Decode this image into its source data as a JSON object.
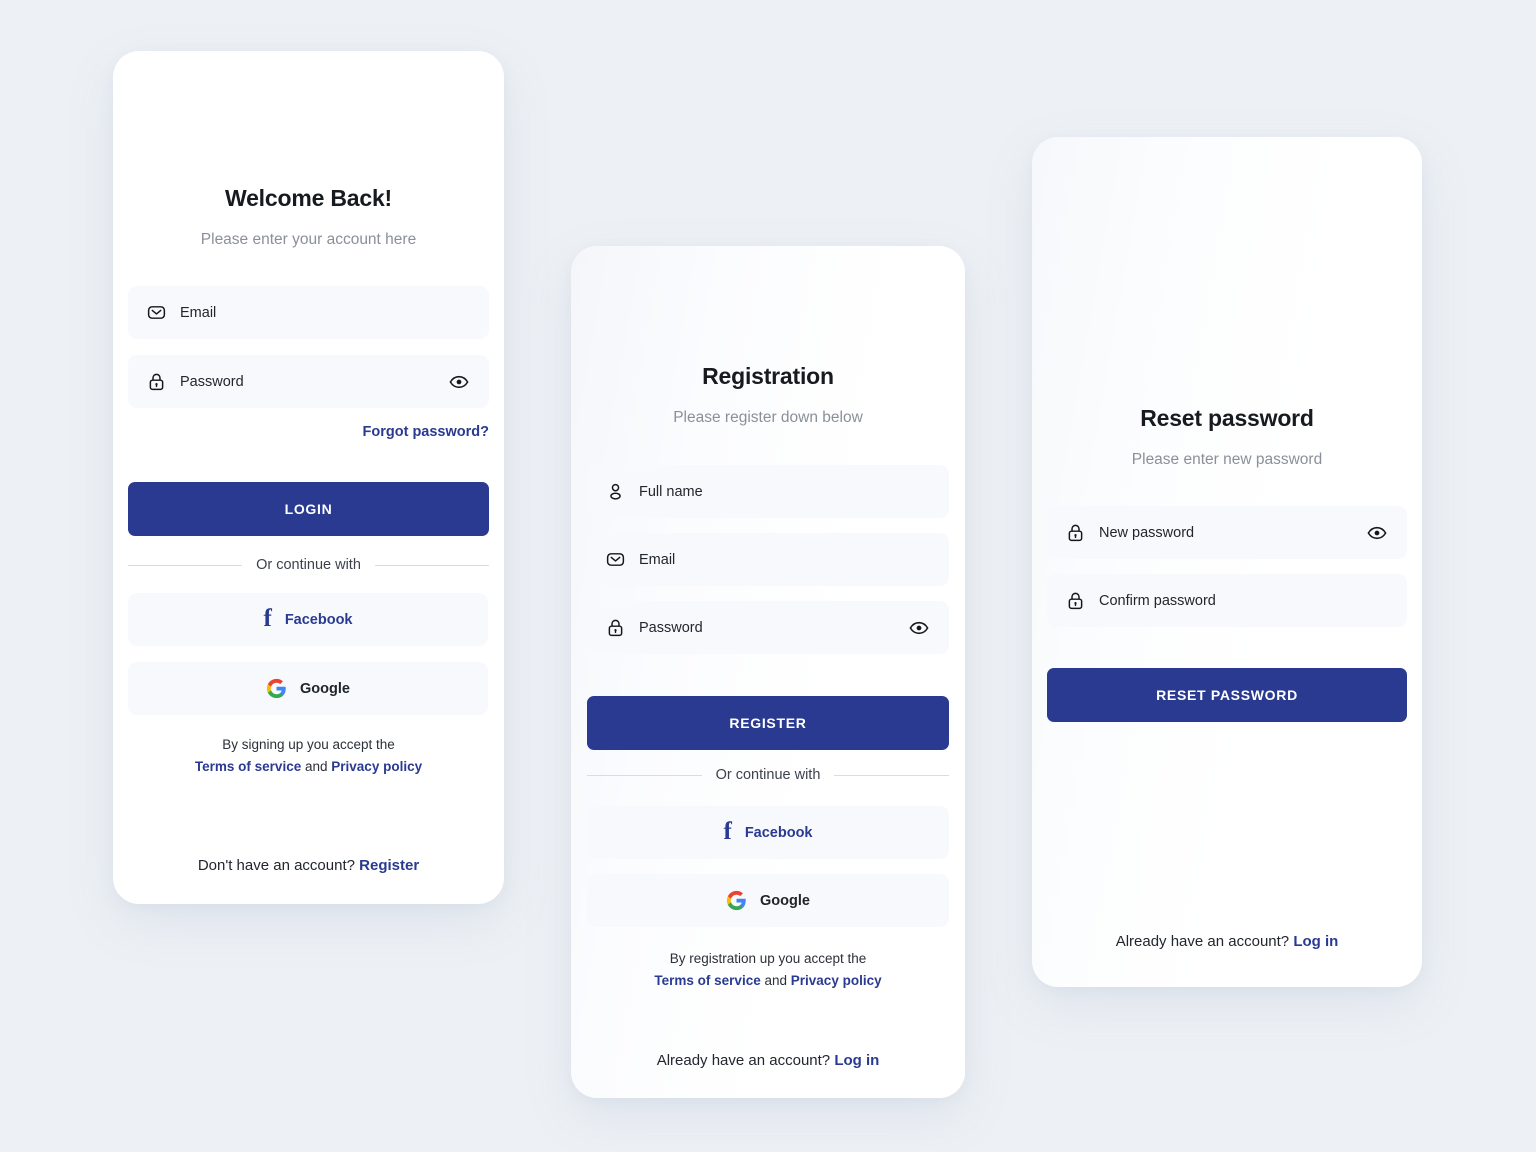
{
  "theme": {
    "page_background": "#edf1f5",
    "card_background": "#ffffff",
    "primary": "#2a3a91",
    "field_background": "#f7f9fc",
    "muted_text": "#8a8f99",
    "body_text": "#22262e"
  },
  "login": {
    "title": "Welcome Back!",
    "subtitle": "Please enter your account here",
    "fields": [
      {
        "label": "Email",
        "icon": "envelope-icon",
        "has_eye": false
      },
      {
        "label": "Password",
        "icon": "lock-icon",
        "has_eye": true
      }
    ],
    "forgot_label": "Forgot password?",
    "submit_label": "LOGIN",
    "divider_label": "Or continue with",
    "social": [
      {
        "label": "Facebook",
        "icon": "facebook-icon"
      },
      {
        "label": "Google",
        "icon": "google-icon"
      }
    ],
    "terms_prefix": "By signing up you accept the",
    "terms_link": "Terms of service",
    "terms_conjunction": "and",
    "privacy_link": "Privacy policy",
    "footer_text": "Don't have an account?",
    "footer_link": "Register"
  },
  "registration": {
    "title": "Registration",
    "subtitle": "Please register down below",
    "fields": [
      {
        "label": "Full name",
        "icon": "person-icon",
        "has_eye": false
      },
      {
        "label": "Email",
        "icon": "envelope-icon",
        "has_eye": false
      },
      {
        "label": "Password",
        "icon": "lock-icon",
        "has_eye": true
      }
    ],
    "submit_label": "REGISTER",
    "divider_label": "Or continue with",
    "social": [
      {
        "label": "Facebook",
        "icon": "facebook-icon"
      },
      {
        "label": "Google",
        "icon": "google-icon"
      }
    ],
    "terms_prefix": "By registration up you accept the",
    "terms_link": "Terms of service",
    "terms_conjunction": "and",
    "privacy_link": "Privacy policy",
    "footer_text": "Already have an account?",
    "footer_link": "Log in"
  },
  "reset": {
    "title": "Reset password",
    "subtitle": "Please enter new password",
    "fields": [
      {
        "label": "New password",
        "icon": "lock-icon",
        "has_eye": true
      },
      {
        "label": "Confirm password",
        "icon": "lock-icon",
        "has_eye": false
      }
    ],
    "submit_label": "RESET PASSWORD",
    "footer_text": "Already have an account?",
    "footer_link": "Log in"
  }
}
